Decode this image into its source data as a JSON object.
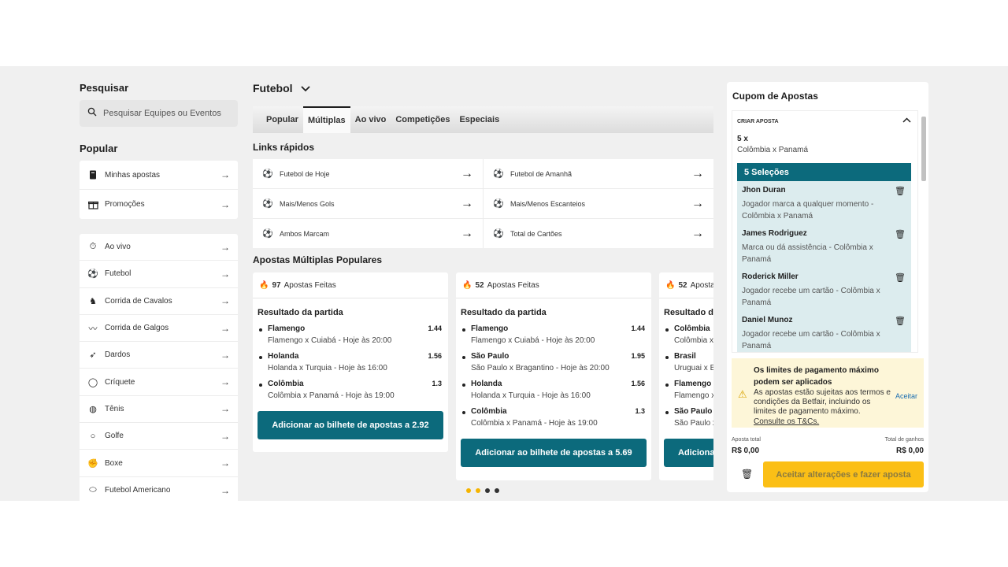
{
  "search": {
    "title": "Pesquisar",
    "placeholder": "Pesquisar Equipes ou Eventos"
  },
  "popular": {
    "title": "Popular",
    "items": [
      {
        "label": "Minhas apostas",
        "icon": "notebook-icon"
      },
      {
        "label": "Promoções",
        "icon": "gift-icon"
      }
    ]
  },
  "sports": [
    {
      "label": "Ao vivo",
      "icon": "stopwatch-icon"
    },
    {
      "label": "Futebol",
      "icon": "soccer-ball-icon"
    },
    {
      "label": "Corrida de Cavalos",
      "icon": "horse-icon"
    },
    {
      "label": "Corrida de Galgos",
      "icon": "greyhound-icon"
    },
    {
      "label": "Dardos",
      "icon": "dart-icon"
    },
    {
      "label": "Críquete",
      "icon": "cricket-ball-icon"
    },
    {
      "label": "Tênis",
      "icon": "tennis-ball-icon"
    },
    {
      "label": "Golfe",
      "icon": "golf-ball-icon"
    },
    {
      "label": "Boxe",
      "icon": "boxing-glove-icon"
    },
    {
      "label": "Futebol Americano",
      "icon": "american-football-icon"
    }
  ],
  "main": {
    "sport_title": "Futebol",
    "tabs": [
      {
        "label": "Popular"
      },
      {
        "label": "Múltiplas"
      },
      {
        "label": "Ao vivo"
      },
      {
        "label": "Competições"
      },
      {
        "label": "Especiais"
      }
    ],
    "quick_links": {
      "title": "Links rápidos",
      "items": [
        {
          "label": "Futebol de Hoje"
        },
        {
          "label": "Futebol de Amanhã"
        },
        {
          "label": "Mais/Menos Gols"
        },
        {
          "label": "Mais/Menos Escanteios"
        },
        {
          "label": "Ambos Marcam"
        },
        {
          "label": "Total de Cartões"
        }
      ]
    },
    "accas": {
      "title": "Apostas Múltiplas Populares",
      "cards": [
        {
          "count": "97",
          "count_label": "Apostas Feitas",
          "market": "Resultado da partida",
          "selections": [
            {
              "name": "Flamengo",
              "event": "Flamengo x Cuiabá - Hoje às 20:00",
              "odd": "1.44"
            },
            {
              "name": "Holanda",
              "event": "Holanda x Turquia - Hoje às 16:00",
              "odd": "1.56"
            },
            {
              "name": "Colômbia",
              "event": "Colômbia x Panamá - Hoje às 19:00",
              "odd": "1.3"
            }
          ],
          "button": "Adicionar ao bilhete de apostas a 2.92"
        },
        {
          "count": "52",
          "count_label": "Apostas Feitas",
          "market": "Resultado da partida",
          "selections": [
            {
              "name": "Flamengo",
              "event": "Flamengo x Cuiabá - Hoje às 20:00",
              "odd": "1.44"
            },
            {
              "name": "São Paulo",
              "event": "São Paulo x Bragantino - Hoje às 20:00",
              "odd": "1.95"
            },
            {
              "name": "Holanda",
              "event": "Holanda x Turquia - Hoje às 16:00",
              "odd": "1.56"
            },
            {
              "name": "Colômbia",
              "event": "Colômbia x Panamá - Hoje às 19:00",
              "odd": "1.3"
            }
          ],
          "button": "Adicionar ao bilhete de apostas a 5.69"
        },
        {
          "count": "52",
          "count_label": "Apostas Feitas",
          "market": "Resultado da partida",
          "selections": [
            {
              "name": "Colômbia",
              "event": "Colômbia x Panamá",
              "odd": ""
            },
            {
              "name": "Brasil",
              "event": "Uruguai x Brasil",
              "odd": ""
            },
            {
              "name": "Flamengo",
              "event": "Flamengo x Cuiabá",
              "odd": ""
            },
            {
              "name": "São Paulo",
              "event": "São Paulo x Bragantino",
              "odd": ""
            }
          ],
          "button": "Adicionar ao bilhete de apostas"
        }
      ],
      "dots": [
        "#f5b400",
        "#f5b400",
        "#333333",
        "#333333"
      ]
    }
  },
  "betslip": {
    "title": "Cupom de Apostas",
    "create_label": "CRIAR APOSTA",
    "quantity": "5 x",
    "quantity_event": "Colômbia x Panamá",
    "selections_header": "5 Seleções",
    "legs": [
      {
        "player": "Jhon Duran",
        "desc": "Jogador marca a qualquer momento - Colômbia x Panamá"
      },
      {
        "player": "James Rodriguez",
        "desc": "Marca ou dá assistência - Colômbia x Panamá"
      },
      {
        "player": "Roderick Miller",
        "desc": "Jogador recebe um cartão - Colômbia x Panamá"
      },
      {
        "player": "Daniel Munoz",
        "desc": "Jogador recebe um cartão - Colômbia x Panamá"
      }
    ],
    "warning": {
      "title": "Os limites de pagamento máximo podem ser aplicados",
      "desc": "As apostas estão sujeitas aos termos e condições da Betfair, incluindo os limites de pagamento máximo.",
      "link": "Consulte os T&Cs.",
      "accept": "Aceitar"
    },
    "total_stake_label": "Aposta total",
    "total_stake": "R$ 0,00",
    "total_return_label": "Total de ganhos",
    "total_return": "R$ 0,00",
    "accept_button": "Aceitar alterações e fazer aposta"
  },
  "colors": {
    "teal": "#0c6a7c",
    "yellow": "#fbbf16",
    "flame": "#f5a623"
  }
}
